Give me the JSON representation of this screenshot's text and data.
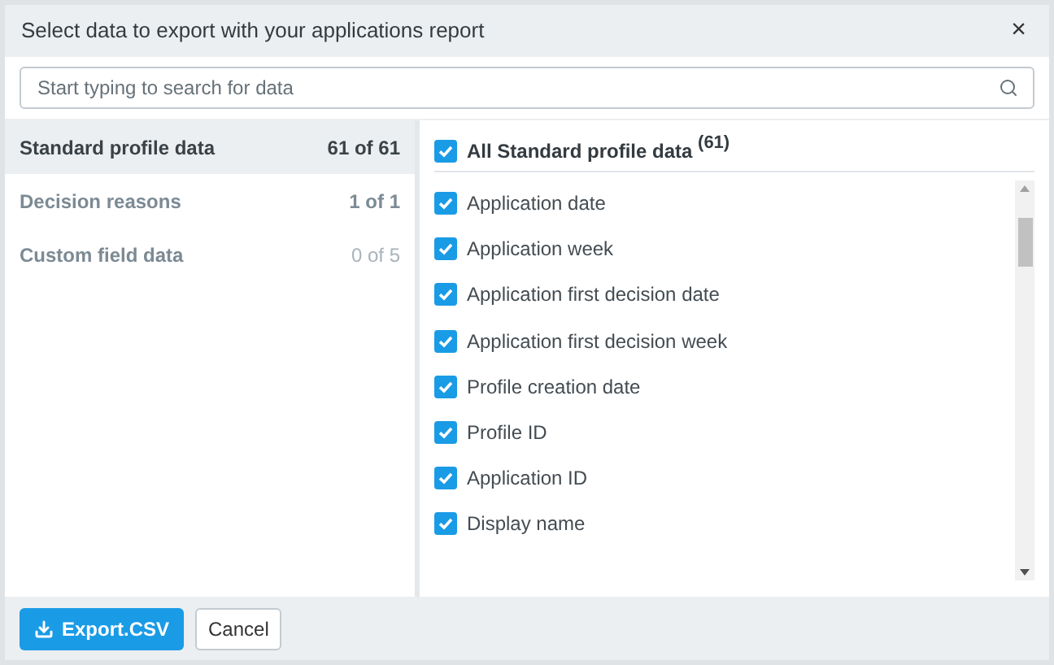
{
  "dialog": {
    "title": "Select data to export with your applications report",
    "close": "×"
  },
  "search": {
    "placeholder": "Start typing to search for data"
  },
  "categories": [
    {
      "label": "Standard profile data",
      "count": "61 of 61",
      "selected": true
    },
    {
      "label": "Decision reasons",
      "count": "1 of 1",
      "selected": false
    },
    {
      "label": "Custom field data",
      "count": "0 of 5",
      "selected": false
    }
  ],
  "all_toggle": {
    "label": "All Standard profile data",
    "count": "(61)",
    "checked": true
  },
  "fields": [
    {
      "label": "Application date",
      "checked": true
    },
    {
      "label": "Application week",
      "checked": true
    },
    {
      "label": "Application first decision date",
      "checked": true
    },
    {
      "label": "Application first decision week",
      "checked": true
    },
    {
      "label": "Profile creation date",
      "checked": true
    },
    {
      "label": "Profile ID",
      "checked": true
    },
    {
      "label": "Application ID",
      "checked": true
    },
    {
      "label": "Display name",
      "checked": true
    }
  ],
  "buttons": {
    "export": "Export.CSV",
    "cancel": "Cancel"
  }
}
